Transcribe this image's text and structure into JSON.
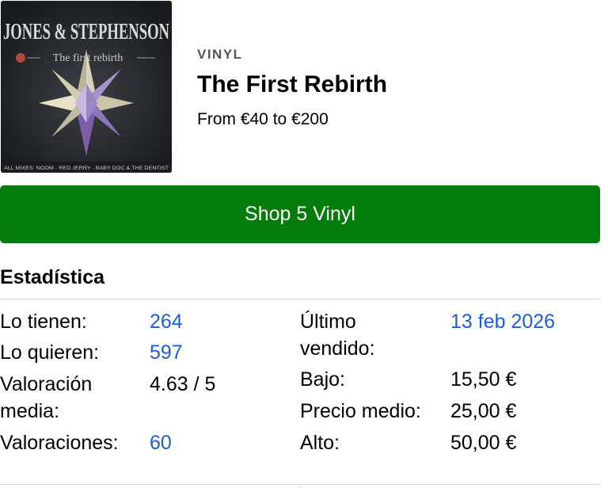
{
  "release": {
    "cover": {
      "artist_text": "JONES & STEPHENSON",
      "subtitle_text": "The first rebirth",
      "footer_text": "ALL MIXES: NOOM · RED JERRY · BABY DOC & THE DENTIST"
    },
    "format": "VINYL",
    "title": "The First Rebirth",
    "price_range": "From €40 to €200"
  },
  "shop_button": {
    "label": "Shop 5 Vinyl"
  },
  "stats": {
    "heading": "Estadística",
    "have_label": "Lo tienen:",
    "have_value": "264",
    "want_label": "Lo quieren:",
    "want_value": "597",
    "rating_label_1": "Valoración",
    "rating_label_2": "media:",
    "rating_value": "4.63 / 5",
    "ratings_label": "Valoraciones:",
    "ratings_value": "60",
    "last_sold_label_1": "Último",
    "last_sold_label_2": "vendido:",
    "last_sold_value": "13 feb 2026",
    "low_label": "Bajo:",
    "low_value": "15,50 €",
    "median_label": "Precio medio:",
    "median_value": "25,00 €",
    "high_label": "Alto:",
    "high_value": "50,00 €"
  },
  "colors": {
    "button_green": "#047c0b",
    "link_blue": "#1d5ed6",
    "format_gray": "#555555"
  }
}
